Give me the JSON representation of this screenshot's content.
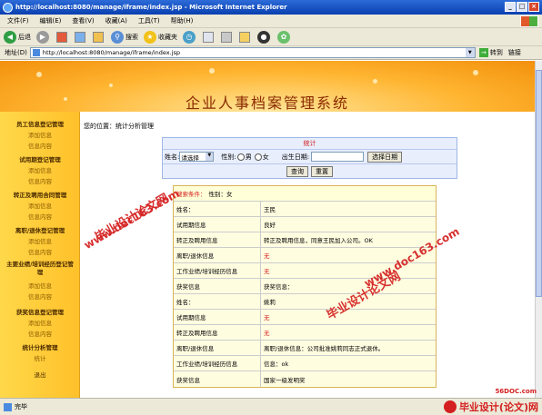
{
  "window": {
    "title": "http://localhost:8080/manage/iframe/index.jsp - Microsoft Internet Explorer"
  },
  "menu": [
    "文件(F)",
    "编辑(E)",
    "查看(V)",
    "收藏(A)",
    "工具(T)",
    "帮助(H)"
  ],
  "toolbar": {
    "back_label": "后退",
    "search_label": "搜索",
    "favorites_label": "收藏夹"
  },
  "address": {
    "label": "地址(D)",
    "url": "http://localhost:8080/manage/iframe/index.jsp",
    "go_label": "转到",
    "links_label": "链接"
  },
  "banner": {
    "title": "企业人事档案管理系统"
  },
  "sidebar": [
    {
      "group": "员工信息登记管理",
      "items": [
        "添加信息",
        "信息内容"
      ]
    },
    {
      "group": "试用期登记管理",
      "items": [
        "添加信息",
        "信息内容"
      ]
    },
    {
      "group": "转正及聘用合同管理",
      "items": [
        "添加信息",
        "信息内容"
      ]
    },
    {
      "group": "离职/退休登记管理",
      "items": [
        "添加信息",
        "信息内容"
      ]
    },
    {
      "group": "主要业绩/培训经历登记管理",
      "items": [
        "添加信息",
        "信息内容"
      ]
    },
    {
      "group": "获奖信息登记管理",
      "items": [
        "添加信息",
        "信息内容"
      ]
    },
    {
      "group": "统计分析管理",
      "items": [
        "统计"
      ]
    },
    {
      "group": "",
      "items": [
        "退出"
      ]
    }
  ],
  "breadcrumb": "您的位置：统计分析管理",
  "search": {
    "title": "统计",
    "name_label": "姓名:",
    "name_select": "请选择",
    "gender_label": "性别:",
    "male": "男",
    "female": "女",
    "birth_label": "出生日期:",
    "date_button": "选择日期",
    "query_button": "查询",
    "reset_button": "重置"
  },
  "result": {
    "condition_label": "搜索条件：",
    "condition_value": "性别：女",
    "rows": [
      {
        "label": "姓名：",
        "value": "王民",
        "red": false
      },
      {
        "label": "试用期信息",
        "value": "良好",
        "red": false
      },
      {
        "label": "转正及聘用信息",
        "value": "转正及聘用信息，同意王民加入公司。OK",
        "red": false
      },
      {
        "label": "离职/退休信息",
        "value": "无",
        "red": true
      },
      {
        "label": "工作业绩/培训经历信息",
        "value": "无",
        "red": true
      },
      {
        "label": "获奖信息",
        "value": "获奖信息：",
        "red": false
      },
      {
        "label": "姓名：",
        "value": "姚莉",
        "red": false
      },
      {
        "label": "试用期信息",
        "value": "无",
        "red": true
      },
      {
        "label": "转正及聘用信息",
        "value": "无",
        "red": true
      },
      {
        "label": "离职/退休信息",
        "value": "离职/退休信息：公司批准姚莉同志正式退休。",
        "red": false
      },
      {
        "label": "工作业绩/培训经历信息",
        "value": "信息：ok",
        "red": false
      },
      {
        "label": "获奖信息",
        "value": "国家一级发明奖",
        "red": false
      }
    ]
  },
  "watermarks": {
    "cn": "毕业设计论文网",
    "url": "www.doc163.com"
  },
  "status": {
    "text": "完毕",
    "site": "56DOC.com",
    "brand": "毕业设计(论文)网"
  }
}
